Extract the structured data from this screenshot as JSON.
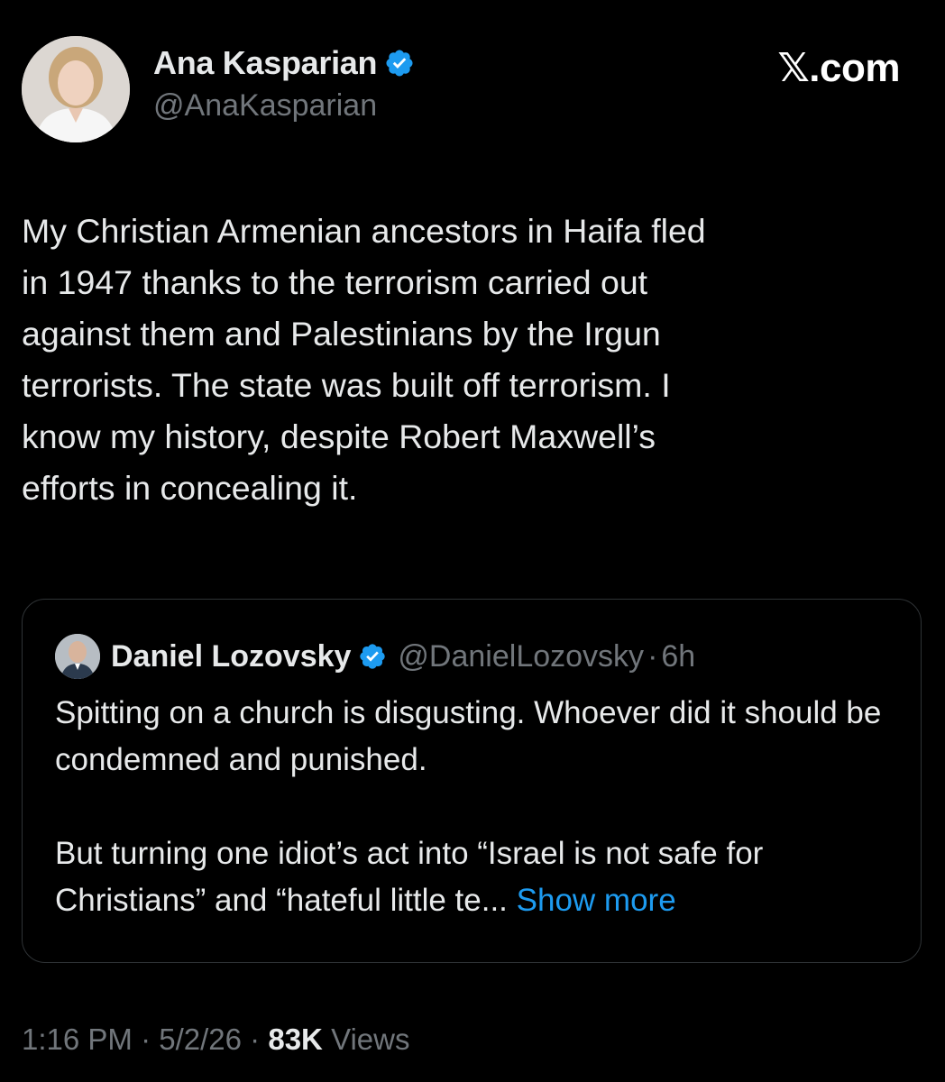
{
  "brand": "𝕏.com",
  "author": {
    "display_name": "Ana Kasparian",
    "handle": "@AnaKasparian",
    "verified": true
  },
  "tweet": {
    "text": "My Christian Armenian ancestors in Haifa fled\nin 1947 thanks to the terrorism carried out\nagainst them and Palestinians by the Irgun\nterrorists. The state was built off terrorism. I\nknow my history, despite Robert Maxwell’s\nefforts in concealing it."
  },
  "quoted": {
    "display_name": "Daniel Lozovsky",
    "handle": "@DanielLozovsky",
    "separator": "·",
    "time": "6h",
    "verified": true,
    "paragraph_1": "Spitting on a church is disgusting. Whoever did it should be condemned and punished.",
    "paragraph_2": "But turning one idiot’s act into “Israel is not safe for Christians” and “hateful little te...",
    "show_more": "Show more"
  },
  "meta": {
    "time": "1:16 PM",
    "separator": "·",
    "date": "5/2/26",
    "views_count": "83K",
    "views_label": "Views"
  },
  "colors": {
    "background": "#000000",
    "text": "#e7e9ea",
    "secondary": "#71767b",
    "accent": "#1d9bf0",
    "border": "#2f3336"
  },
  "icons": {
    "verified": "verified-badge-icon",
    "avatar": "avatar",
    "quoted_avatar": "avatar"
  }
}
